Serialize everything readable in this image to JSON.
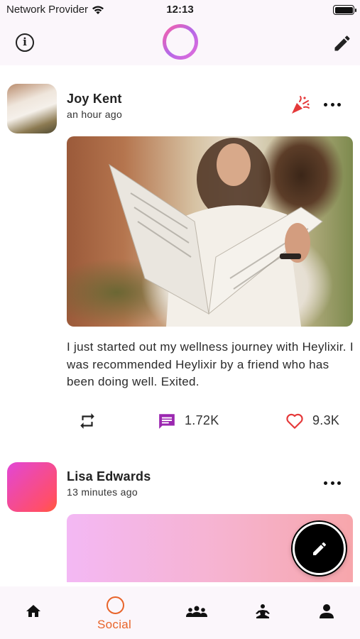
{
  "status_bar": {
    "carrier": "Network Provider",
    "time": "12:13",
    "icons": [
      "wifi-icon",
      "battery-icon"
    ]
  },
  "header": {
    "left_icon": "info-icon",
    "center_icon": "app-logo-ring",
    "right_icon": "edit-icon"
  },
  "posts": [
    {
      "author": "Joy Kent",
      "time": "an hour ago",
      "badge_icon": "celebrate-icon",
      "image": "woman-reading-newspaper-photo",
      "text": "I just started out my wellness journey with Heylixir. I was recommended Heylixir by a friend who has been doing well. Exited.",
      "comments": "1.72K",
      "likes": "9.3K"
    },
    {
      "author": "Lisa Edwards",
      "time": "13 minutes ago",
      "image": "gradient-card"
    }
  ],
  "fab": {
    "icon": "edit-icon"
  },
  "bottom_nav": {
    "items": [
      {
        "icon": "home-icon",
        "label": ""
      },
      {
        "icon": "social-ring-icon",
        "label": "Social",
        "active": true
      },
      {
        "icon": "groups-icon",
        "label": ""
      },
      {
        "icon": "meditation-icon",
        "label": ""
      },
      {
        "icon": "profile-icon",
        "label": ""
      }
    ],
    "active_color": "#e8642a"
  },
  "colors": {
    "accent": "#e8642a",
    "comment_purple": "#9b27b0",
    "heart_red": "#e5393a",
    "header_bg": "#fbf6fb"
  }
}
